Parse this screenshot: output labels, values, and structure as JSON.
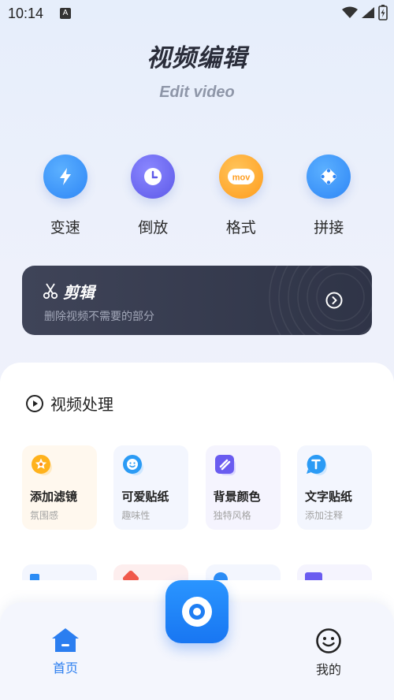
{
  "status": {
    "time": "10:14",
    "indicator": "A"
  },
  "header": {
    "title": "视频编辑",
    "subtitle": "Edit video"
  },
  "tools": [
    {
      "label": "变速",
      "icon": "lightning-icon",
      "color": "#2f8dfb"
    },
    {
      "label": "倒放",
      "icon": "clock-icon",
      "color": "#6a67f0"
    },
    {
      "label": "格式",
      "icon": "mov-icon",
      "color": "#ffa021",
      "icon_text": "mov"
    },
    {
      "label": "拼接",
      "icon": "connect-icon",
      "color": "#2f8dfb"
    }
  ],
  "cut_card": {
    "title": "剪辑",
    "desc": "删除视频不需要的部分"
  },
  "section": {
    "title": "视频处理"
  },
  "features": [
    {
      "name": "添加滤镜",
      "desc": "氛围感",
      "icon": "star-icon",
      "bg": "#fff8ee",
      "icon_color": "#ffb21c"
    },
    {
      "name": "可爱贴纸",
      "desc": "趣味性",
      "icon": "smile-icon",
      "bg": "#f3f6fe",
      "icon_color": "#2b9bf5"
    },
    {
      "name": "背景颜色",
      "desc": "独特风格",
      "icon": "palette-icon",
      "bg": "#f5f4fe",
      "icon_color": "#6a5cf0"
    },
    {
      "name": "文字贴纸",
      "desc": "添加注释",
      "icon": "text-icon",
      "bg": "#f3f6fe",
      "icon_color": "#2b9bf5"
    }
  ],
  "bottom_nav": {
    "home": "首页",
    "mine": "我的"
  },
  "colors": {
    "accent": "#2b7ef0",
    "card_dark": "#363b4e"
  }
}
